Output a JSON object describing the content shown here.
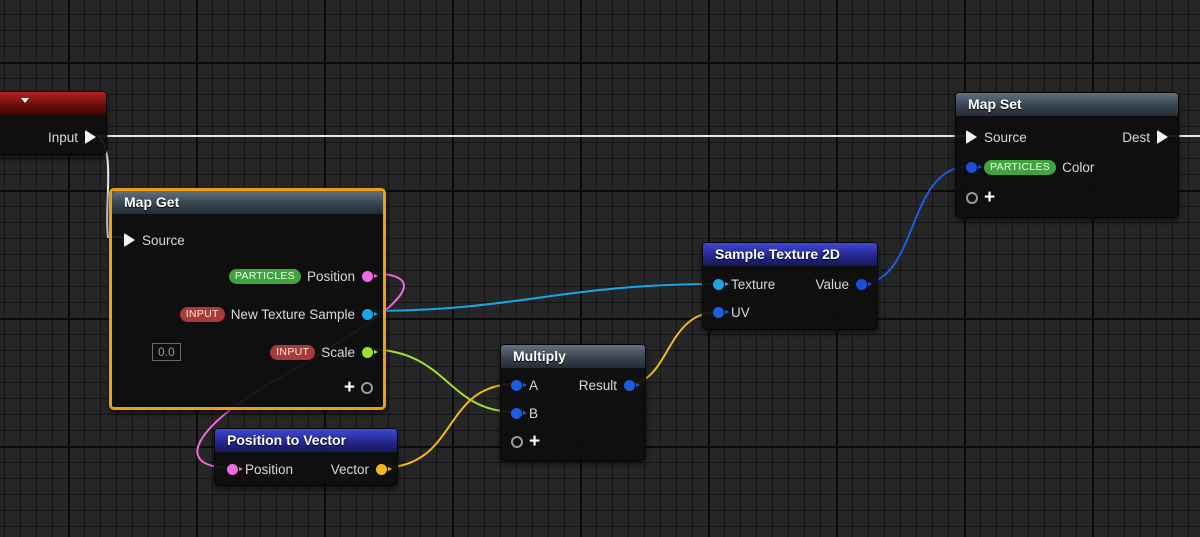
{
  "colors": {
    "exec": "#f2f2f2",
    "position": "#f06ae0",
    "texture": "#19a6e8",
    "float": "#9ee034",
    "vector": "#f2b91c",
    "vector2": "#1a5de0",
    "color": "#1a4fd8",
    "selection": "#f09d1c"
  },
  "nodes": {
    "input_node": {
      "caret_icon": "chevron-down-icon",
      "output_label": "Input"
    },
    "map_get": {
      "title": "Map Get",
      "source_label": "Source",
      "position": {
        "badge": "PARTICLES",
        "label": "Position"
      },
      "texture": {
        "badge": "INPUT",
        "label": "New Texture Sample"
      },
      "scale": {
        "badge": "INPUT",
        "label": "Scale",
        "default_value": "0.0"
      },
      "add_pin": "+"
    },
    "position_to_vector": {
      "title": "Position to Vector",
      "input_label": "Position",
      "output_label": "Vector"
    },
    "multiply": {
      "title": "Multiply",
      "a_label": "A",
      "b_label": "B",
      "output_label": "Result",
      "add_pin": "+"
    },
    "sample_texture": {
      "title": "Sample Texture 2D",
      "texture_label": "Texture",
      "uv_label": "UV",
      "output_label": "Value"
    },
    "map_set": {
      "title": "Map Set",
      "source_label": "Source",
      "dest_label": "Dest",
      "color": {
        "badge": "PARTICLES",
        "label": "Color"
      },
      "add_pin": "+"
    }
  }
}
